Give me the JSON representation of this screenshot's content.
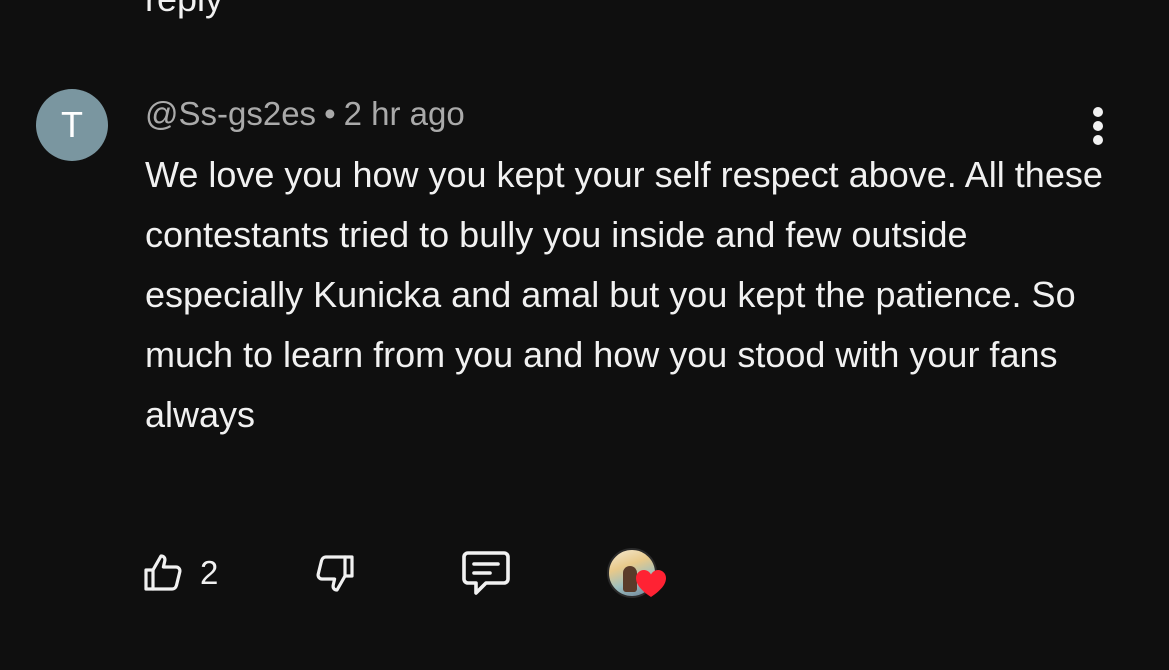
{
  "previous": {
    "trailing_text": "reply"
  },
  "comment": {
    "avatar_initial": "T",
    "author": "@Ss-gs2es",
    "separator": "•",
    "time": "2 hr ago",
    "text": "We love you how you kept your self respect above. All these contestants tried to bully you inside and few outside especially Kunicka and amal but you kept the patience. So much to learn from you and how you stood with your fans always",
    "like_count": "2"
  },
  "icons": {
    "more": "more-vertical-icon",
    "like": "thumb-up-icon",
    "dislike": "thumb-down-icon",
    "reply": "comment-reply-icon",
    "heart": "heart-icon"
  },
  "colors": {
    "background": "#0f0f0f",
    "text": "#f1f1f1",
    "meta": "#aaaaaa",
    "avatar": "#7a96a0",
    "heart": "#ff2233"
  }
}
